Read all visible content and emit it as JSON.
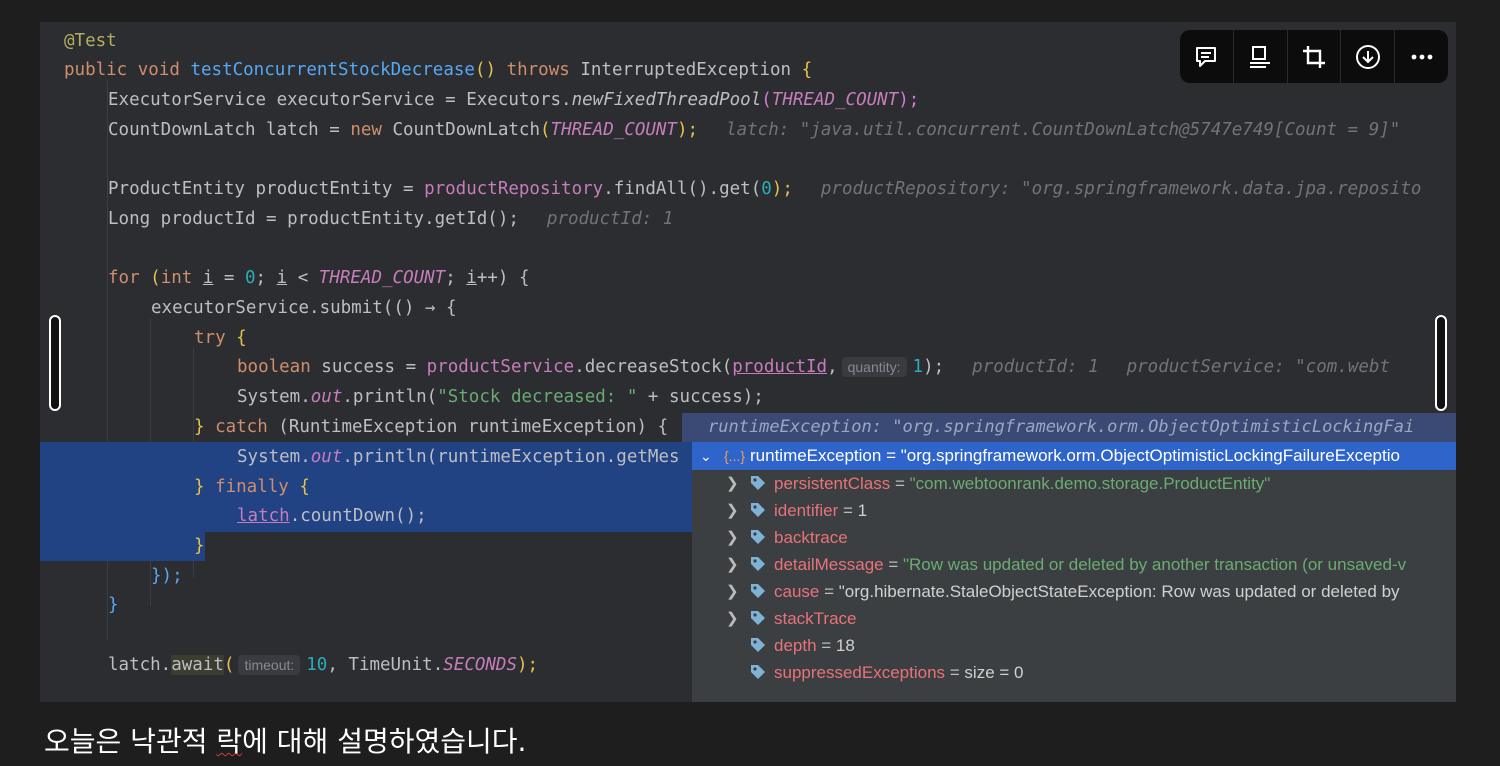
{
  "toolbar": {
    "buttons": [
      "comment-icon",
      "caption-icon",
      "crop-icon",
      "download-icon",
      "more-icon"
    ]
  },
  "code": {
    "l1_annotation": "@Test",
    "l2_public": "public",
    "l2_void": "void",
    "l2_method": "testConcurrentStockDecrease",
    "l2_parens": "()",
    "l2_throws": "throws",
    "l2_exc": "InterruptedException",
    "l2_brace": "{",
    "l3_a": "ExecutorService executorService = Executors.",
    "l3_b": "newFixedThreadPool",
    "l3_c": "THREAD_COUNT",
    "l3_d": ");",
    "l4_a": "CountDownLatch latch = ",
    "l4_new": "new",
    "l4_b": " CountDownLatch",
    "l4_c": "THREAD_COUNT",
    "l4_d": ");",
    "l4_inlay": "latch: \"java.util.concurrent.CountDownLatch@5747e749[Count = 9]\"",
    "l6_a": "ProductEntity productEntity = ",
    "l6_b": "productRepository",
    "l6_c": ".findAll().get(",
    "l6_d": "0",
    "l6_e": ");",
    "l6_inlay": "productRepository: \"org.springframework.data.jpa.reposito",
    "l7_a": "Long productId = productEntity.getId();",
    "l7_inlay": "productId: 1",
    "l9_for": "for",
    "l9_a": " (",
    "l9_int": "int",
    "l9_i1": "i",
    "l9_eq": " = ",
    "l9_zero": "0",
    "l9_semi": "; ",
    "l9_i2": "i",
    "l9_lt": " < ",
    "l9_const": "THREAD_COUNT",
    "l9_semi2": "; ",
    "l9_i3": "i",
    "l9_inc": "++) {",
    "l10_a": "executorService.submit(() → {",
    "l11_try": "try",
    "l11_brace": " {",
    "l12_bool": "boolean",
    "l12_a": " success = ",
    "l12_svc": "productService",
    "l12_b": ".decreaseStock(",
    "l12_pid": "productId",
    "l12_c": ",",
    "l12_hint": "quantity:",
    "l12_one": "1",
    "l12_d": ");",
    "l12_inlay1": "productId: 1",
    "l12_inlay2": "productService: \"com.webt",
    "l13_a": "System.",
    "l13_out": "out",
    "l13_b": ".println(",
    "l13_str": "\"Stock decreased: \"",
    "l13_c": " + success);",
    "l14_a": "} ",
    "l14_catch": "catch",
    "l14_b": " (RuntimeException runtimeException) {",
    "l15_a": "System.",
    "l15_out": "out",
    "l15_b": ".println(runtimeException.getMes",
    "l16_a": "} ",
    "l16_finally": "finally",
    "l16_b": " {",
    "l17_latch": "latch",
    "l17_b": ".countDown();",
    "l18_a": "}",
    "l19_a": "});",
    "l20_a": "}",
    "l22_a": "latch.",
    "l22_await": "await",
    "l22_paren": "(",
    "l22_hint": "timeout:",
    "l22_ten": "10",
    "l22_b": ", TimeUnit.",
    "l22_sec": "SECONDS",
    "l22_c": ");"
  },
  "tooltip_bar": "runtimeException: \"org.springframework.orm.ObjectOptimisticLockingFai",
  "debug_popup": {
    "header": "runtimeException = \"org.springframework.orm.ObjectOptimisticLockingFailureExceptio",
    "header_icon": "{...}",
    "rows": [
      {
        "name": "persistentClass",
        "eq": " = ",
        "value": "\"com.webtoonrank.demo.storage.ProductEntity\""
      },
      {
        "name": "identifier",
        "eq": " = ",
        "value": "1"
      },
      {
        "name": "backtrace",
        "eq": "",
        "value": ""
      },
      {
        "name": "detailMessage",
        "eq": " = ",
        "value": "\"Row was updated or deleted by another transaction (or unsaved-v"
      },
      {
        "name": "cause",
        "eq": " = ",
        "value": "\"org.hibernate.StaleObjectStateException: Row was updated or deleted by"
      },
      {
        "name": "stackTrace",
        "eq": "",
        "value": ""
      },
      {
        "name": "depth",
        "eq": " = ",
        "value": "18"
      },
      {
        "name": "suppressedExceptions",
        "eq": " = ",
        "value": " size = 0"
      }
    ]
  },
  "caption": {
    "before": "오늘은 낙관적 ",
    "misspelled": "락",
    "after": "에 대해 설명하였습니다."
  }
}
